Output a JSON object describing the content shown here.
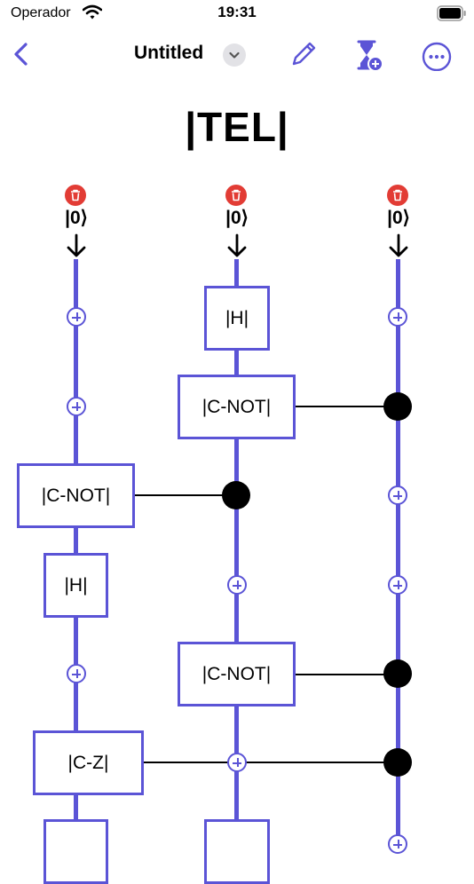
{
  "status_bar": {
    "carrier": "Operador",
    "time": "19:31"
  },
  "nav": {
    "title": "Untitled",
    "icons": [
      "chevron-left-icon",
      "chevron-down-icon",
      "pencil-icon",
      "hourglass-plus-icon",
      "ellipsis-circle-icon"
    ]
  },
  "circuit": {
    "title": "|TEL|",
    "qubits": [
      {
        "initial": "|0⟩",
        "gates": [
          "|C-NOT|",
          "|H|",
          "|C-Z|"
        ]
      },
      {
        "initial": "|0⟩",
        "gates": [
          "|H|",
          "|C-NOT|",
          "|C-NOT|"
        ]
      },
      {
        "initial": "|0⟩",
        "gates": []
      }
    ]
  },
  "colors": {
    "accent": "#5b54d6",
    "delete": "#e23c35",
    "control": "#000000"
  }
}
